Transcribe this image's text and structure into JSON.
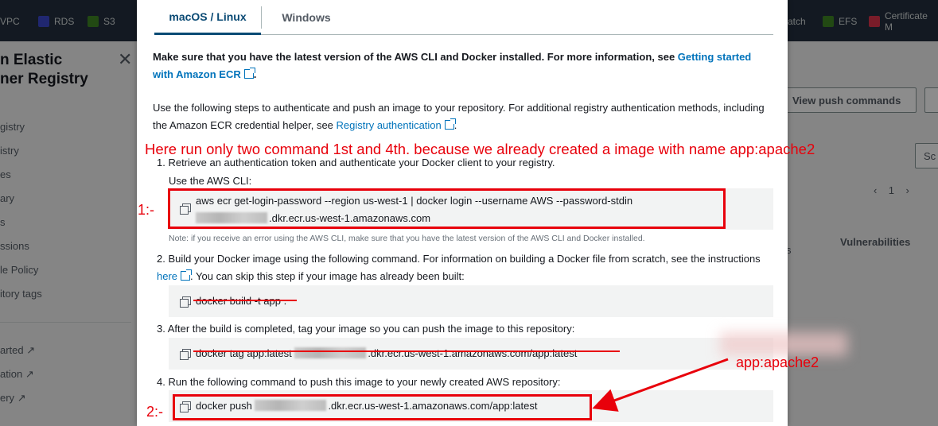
{
  "background": {
    "favorites": [
      {
        "label": "VPC",
        "color": "#8c4fff"
      },
      {
        "label": "RDS",
        "color": "#3b48cc"
      },
      {
        "label": "S3",
        "color": "#3f8624"
      },
      {
        "label": "atch",
        "color": "#e7157b"
      },
      {
        "label": "EFS",
        "color": "#3f8624"
      },
      {
        "label": "Certificate M",
        "color": "#dd344c"
      }
    ],
    "sidebar_title": "n Elastic\nner Registry",
    "sidebar_items": [
      "gistry",
      "istry",
      "es",
      "ary",
      "s",
      "ssions",
      "le Policy",
      "itory tags"
    ],
    "sidebar_links": [
      "arted",
      "ation",
      "ery"
    ],
    "view_push_commands": "View push commands",
    "search_stub": "Sc",
    "pager_page": "1",
    "col_s": "s",
    "col_vulnerabilities": "Vulnerabilities"
  },
  "modal": {
    "tabs": [
      {
        "label": "macOS / Linux",
        "active": true
      },
      {
        "label": "Windows",
        "active": false
      }
    ],
    "intro_text": "Make sure that you have the latest version of the AWS CLI and Docker installed. For more information, see ",
    "intro_link": "Getting started with Amazon ECR",
    "intro_end": ".",
    "steps_intro_text": "Use the following steps to authenticate and push an image to your repository. For additional registry authentication methods, including the Amazon ECR credential helper, see ",
    "steps_intro_link": "Registry authentication",
    "steps_intro_end": ".",
    "step1_text": "1. Retrieve an authentication token and authenticate your Docker client to your registry.",
    "step1_sub": "Use the AWS CLI:",
    "step1_cmd_line1": "aws ecr get-login-password --region us-west-1 | docker login --username AWS --password-stdin",
    "step1_cmd_line2_suffix": ".dkr.ecr.us-west-1.amazonaws.com",
    "step1_note": "Note: if you receive an error using the AWS CLI, make sure that you have the latest version of the AWS CLI and Docker installed.",
    "step2_text_a": "2. Build your Docker image using the following command. For information on building a Docker file from scratch, see the instructions ",
    "step2_link": "here",
    "step2_text_b": ". You can skip this step if your image has already been built:",
    "step2_cmd": "docker build -t app .",
    "step3_text": "3. After the build is completed, tag your image so you can push the image to this repository:",
    "step3_cmd_prefix": "docker tag app:latest ",
    "step3_cmd_suffix": ".dkr.ecr.us-west-1.amazonaws.com/app:latest",
    "step4_text": "4. Run the following command to push this image to your newly created AWS repository:",
    "step4_cmd_prefix": "docker push ",
    "step4_cmd_suffix": ".dkr.ecr.us-west-1.amazonaws.com/app:latest"
  },
  "annotations": {
    "header_note": "Here run only two command 1st and 4th. because we already created a image with name app:apache2",
    "label_1": "1:-",
    "label_2": "2:-",
    "tag_note": "app:apache2",
    "color": "#e8000b"
  }
}
